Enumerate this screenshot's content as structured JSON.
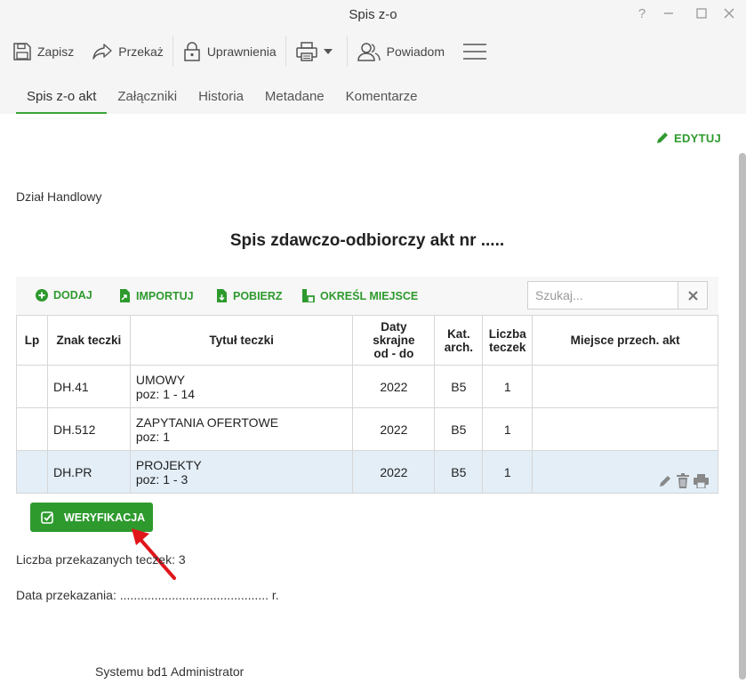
{
  "window": {
    "title": "Spis z-o",
    "help": "?"
  },
  "toolbar": {
    "save_label": "Zapisz",
    "forward_label": "Przekaż",
    "permissions_label": "Uprawnienia",
    "notify_label": "Powiadom"
  },
  "tabs": [
    {
      "label": "Spis z-o akt",
      "active": true
    },
    {
      "label": "Załączniki"
    },
    {
      "label": "Historia"
    },
    {
      "label": "Metadane"
    },
    {
      "label": "Komentarze"
    }
  ],
  "edit_label": "EDYTUJ",
  "department": "Dział Handlowy",
  "document_title": "Spis zdawczo-odbiorczy akt nr .....",
  "actions": {
    "add": "DODAJ",
    "import": "IMPORTUJ",
    "download": "POBIERZ",
    "set_location": "OKREŚL MIEJSCE",
    "search_placeholder": "Szukaj..."
  },
  "table": {
    "headers": {
      "lp": "Lp",
      "znak": "Znak teczki",
      "tytul": "Tytuł teczki",
      "daty_1": "Daty",
      "daty_2": "skrajne",
      "daty_3": "od - do",
      "kat_1": "Kat.",
      "kat_2": "arch.",
      "liczba_1": "Liczba",
      "liczba_2": "teczek",
      "miejsce": "Miejsce przech. akt"
    },
    "rows": [
      {
        "lp": "",
        "znak": "DH.41",
        "tytul": "UMOWY",
        "poz": "poz: 1 - 14",
        "daty": "2022",
        "kat": "B5",
        "liczba": "1",
        "miejsce": ""
      },
      {
        "lp": "",
        "znak": "DH.512",
        "tytul": "ZAPYTANIA OFERTOWE",
        "poz": "poz: 1",
        "daty": "2022",
        "kat": "B5",
        "liczba": "1",
        "miejsce": ""
      },
      {
        "lp": "",
        "znak": "DH.PR",
        "tytul": "PROJEKTY",
        "poz": "poz: 1 - 3",
        "daty": "2022",
        "kat": "B5",
        "liczba": "1",
        "miejsce": ""
      }
    ]
  },
  "verify_label": "WERYFIKACJA",
  "count_line": "Liczba przekazanych teczek: 3",
  "date_line": "Data przekazania: ........................................... r.",
  "signer": "Systemu bd1 Administrator",
  "colors": {
    "accent": "#2e9a2e",
    "selected_row": "#e3eef7",
    "arrow": "#e0161b"
  }
}
